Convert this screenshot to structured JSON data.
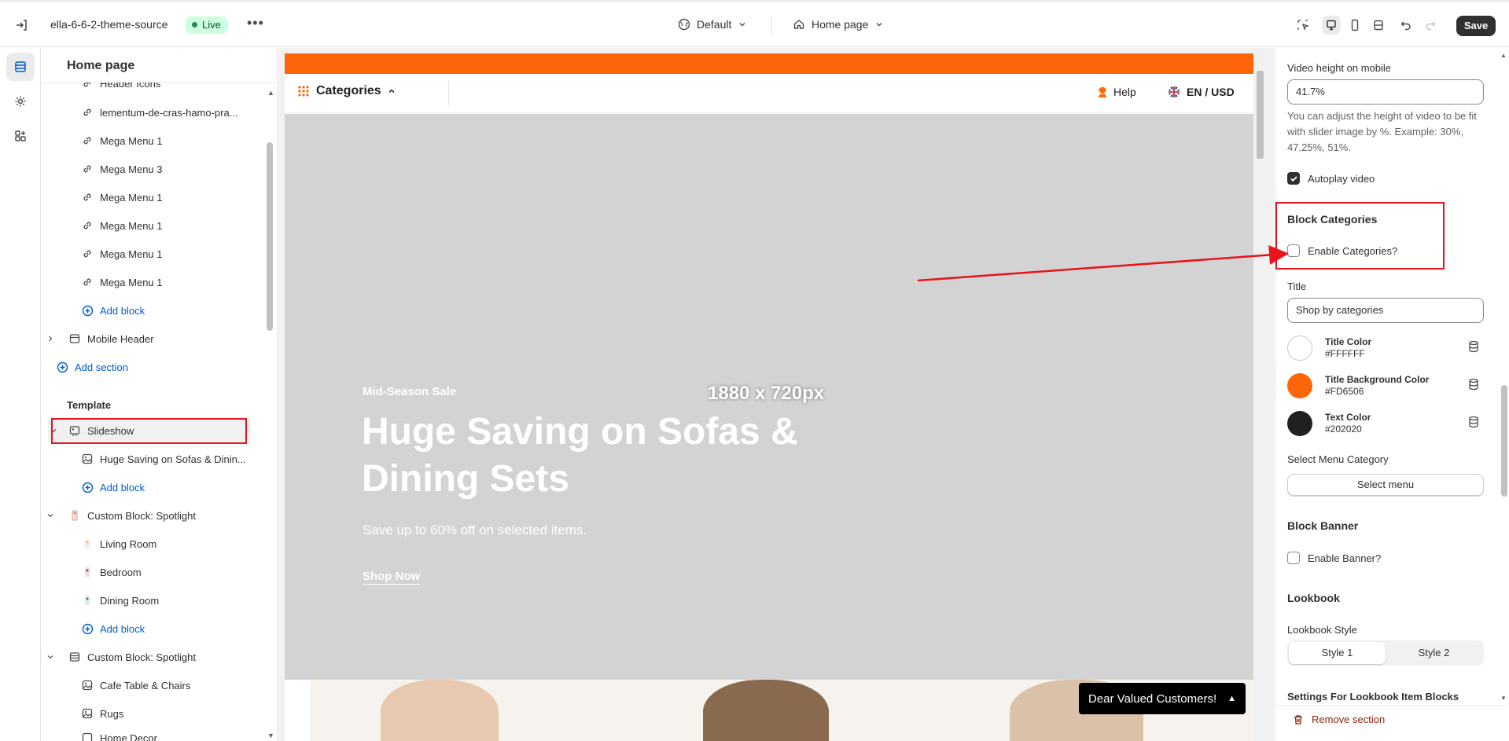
{
  "topbar": {
    "store_name": "ella-6-6-2-theme-source",
    "status": "Live",
    "more": "•••",
    "theme_selector": "Default",
    "page_selector": "Home page",
    "save_label": "Save"
  },
  "sidebar": {
    "title": "Home page",
    "header_items": [
      {
        "label": "Header Icons"
      },
      {
        "label": "lementum-de-cras-hamo-pra..."
      },
      {
        "label": "Mega Menu 1"
      },
      {
        "label": "Mega Menu 3"
      },
      {
        "label": "Mega Menu 1"
      },
      {
        "label": "Mega Menu 1"
      },
      {
        "label": "Mega Menu 1"
      },
      {
        "label": "Mega Menu 1"
      }
    ],
    "add_block_label": "Add block",
    "mobile_header": "Mobile Header",
    "add_section_label": "Add section",
    "template_label": "Template",
    "slideshow": {
      "label": "Slideshow",
      "child": "Huge Saving on Sofas & Dinin..."
    },
    "spotlight_1": {
      "label": "Custom Block: Spotlight",
      "children": [
        "Living Room",
        "Bedroom",
        "Dining Room"
      ]
    },
    "spotlight_2": {
      "label": "Custom Block: Spotlight",
      "children": [
        "Cafe Table & Chairs",
        "Rugs",
        "Home Decor"
      ]
    }
  },
  "preview": {
    "categories_label": "Categories",
    "help_label": "Help",
    "lang_currency": "EN / USD",
    "image_size": "1880 x 720px",
    "kicker": "Mid-Season Sale",
    "headline": "Huge Saving on Sofas & Dining Sets",
    "subtext": "Save up to 60% off on selected items.",
    "cta": "Shop Now",
    "notice": "Dear Valued Customers!",
    "colors": {
      "accent": "#FD6506",
      "hero_bg": "#D3D3D3"
    }
  },
  "settings": {
    "video_height_label": "Video height on mobile",
    "video_height_value": "41.7%",
    "video_height_help": "You can adjust the height of video to be fit with slider image by %. Example: 30%, 47.25%, 51%.",
    "autoplay_label": "Autoplay video",
    "autoplay_checked": true,
    "block_categories_heading": "Block Categories",
    "enable_categories_label": "Enable Categories?",
    "enable_categories_checked": false,
    "title_label": "Title",
    "title_value": "Shop by categories",
    "colors": [
      {
        "name": "Title Color",
        "hex": "#FFFFFF"
      },
      {
        "name": "Title Background Color",
        "hex": "#FD6506"
      },
      {
        "name": "Text Color",
        "hex": "#202020"
      }
    ],
    "select_menu_category_label": "Select Menu Category",
    "select_menu_button": "Select menu",
    "block_banner_heading": "Block Banner",
    "enable_banner_label": "Enable Banner?",
    "lookbook_heading": "Lookbook",
    "lookbook_style_label": "Lookbook Style",
    "lookbook_styles": [
      "Style 1",
      "Style 2"
    ],
    "lookbook_selected": "Style 1",
    "lookbook_items_heading": "Settings For Lookbook Item Blocks",
    "remove_section_label": "Remove section"
  },
  "annotation": {
    "color": "#E8131B"
  }
}
